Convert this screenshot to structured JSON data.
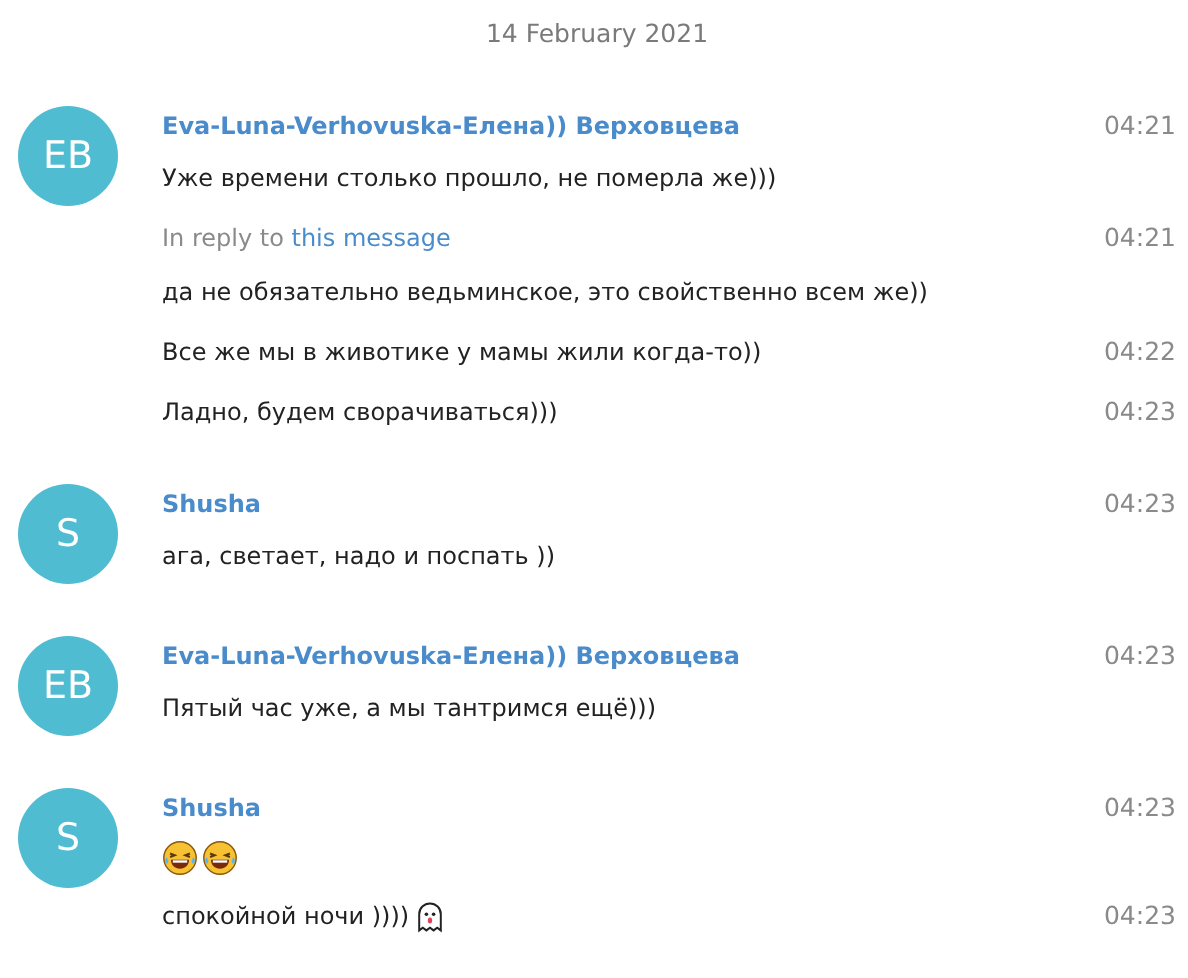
{
  "date": "14 February 2021",
  "groups": [
    {
      "initials": "EB",
      "author": "Eva-Luna-Verhovuska-Елена)) Верховцева",
      "messages": [
        {
          "text": "Уже времени столько прошло, не померла же)))",
          "time": "04:21"
        },
        {
          "reply": {
            "prefix": "In reply to",
            "link": "this message"
          },
          "text": "да не обязательно ведьминское, это свойственно всем же))",
          "time": "04:21"
        },
        {
          "text": "Все же мы в животике у мамы жили когда-то))",
          "time": "04:22"
        },
        {
          "text": "Ладно, будем сворачиваться)))",
          "time": "04:23"
        }
      ]
    },
    {
      "initials": "S",
      "author": "Shusha",
      "messages": [
        {
          "text": "ага, светает, надо и поспать ))",
          "time": "04:23"
        }
      ]
    },
    {
      "initials": "EB",
      "author": "Eva-Luna-Verhovuska-Елена)) Верховцева",
      "messages": [
        {
          "text": "Пятый час уже, а мы тантримся ещё)))",
          "time": "04:23"
        }
      ]
    },
    {
      "initials": "S",
      "author": "Shusha",
      "messages": [
        {
          "emoji": [
            {
              "kind": "laughing"
            },
            {
              "kind": "laughing"
            }
          ],
          "time": "04:23"
        },
        {
          "text": "спокойной ночи ))))",
          "emoji": [
            {
              "kind": "ghost"
            }
          ],
          "time": "04:23"
        }
      ]
    }
  ]
}
